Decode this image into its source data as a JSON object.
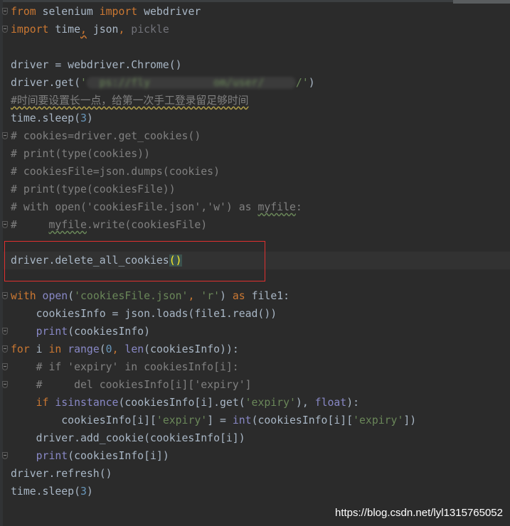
{
  "colors": {
    "background": "#2b2b2b",
    "keyword": "#cc7832",
    "text": "#a9b7c6",
    "builtin": "#8888c6",
    "string": "#6a8759",
    "number": "#6897bb",
    "comment": "#808080",
    "highlight_box": "#e0302f"
  },
  "current_line": 15,
  "highlight_box_line": 15,
  "fold_lines": [
    1,
    2,
    8,
    13,
    17,
    19,
    20,
    21,
    22,
    26
  ],
  "lines": [
    [
      [
        "from",
        "k"
      ],
      [
        " selenium ",
        "t"
      ],
      [
        "import",
        "k"
      ],
      [
        " webdriver",
        "t"
      ]
    ],
    [
      [
        "import",
        "k"
      ],
      [
        " time",
        "t"
      ],
      [
        ",",
        "k wo"
      ],
      [
        " json",
        "t"
      ],
      [
        ", ",
        "k"
      ],
      [
        "pickle",
        "u"
      ]
    ],
    [],
    [
      [
        "driver = webdriver.Chrome()",
        "t"
      ]
    ],
    [
      [
        "driver.get(",
        "t"
      ],
      [
        "'",
        "s"
      ],
      [
        "  ps://fly          om/user/     ",
        "blur"
      ],
      [
        "/'",
        "s"
      ],
      [
        ")",
        "t"
      ]
    ],
    [
      [
        "#时间要设置长一点，给第一次手工登录留足够时间",
        "c wv"
      ]
    ],
    [
      [
        "time.sleep(",
        "t"
      ],
      [
        "3",
        "n"
      ],
      [
        ")",
        "t"
      ]
    ],
    [
      [
        "# cookies=driver.get_cookies()",
        "c"
      ]
    ],
    [
      [
        "# print(type(cookies))",
        "c"
      ]
    ],
    [
      [
        "# cookiesFile=json.dumps(cookies)",
        "c"
      ]
    ],
    [
      [
        "# print(type(cookiesFile))",
        "c"
      ]
    ],
    [
      [
        "# with open('cookiesFile.json','w') as ",
        "c"
      ],
      [
        "myfile",
        "c wg"
      ],
      [
        ":",
        "c"
      ]
    ],
    [
      [
        "#     ",
        "c"
      ],
      [
        "myfile",
        "c wg"
      ],
      [
        ".write(cookiesFile)",
        "c"
      ]
    ],
    [],
    [
      [
        "driver.delete_all_cookies",
        "t"
      ],
      [
        "()",
        "pm"
      ]
    ],
    [],
    [
      [
        "with ",
        "k"
      ],
      [
        "open",
        "b"
      ],
      [
        "(",
        "t"
      ],
      [
        "'cookiesFile.json'",
        "s"
      ],
      [
        ", ",
        "k"
      ],
      [
        "'r'",
        "s"
      ],
      [
        ") ",
        "t"
      ],
      [
        "as ",
        "k"
      ],
      [
        "file1:",
        "t"
      ]
    ],
    [
      [
        "    cookiesInfo = json.loads(file1.read())",
        "t"
      ]
    ],
    [
      [
        "    ",
        "t"
      ],
      [
        "print",
        "b"
      ],
      [
        "(cookiesInfo)",
        "t"
      ]
    ],
    [
      [
        "for ",
        "k"
      ],
      [
        "i ",
        "t"
      ],
      [
        "in ",
        "k"
      ],
      [
        "range",
        "b"
      ],
      [
        "(",
        "t"
      ],
      [
        "0",
        "n"
      ],
      [
        ", ",
        "k"
      ],
      [
        "len",
        "b"
      ],
      [
        "(cookiesInfo)):",
        "t"
      ]
    ],
    [
      [
        "    # if 'expiry' in cookiesInfo[i]:",
        "c"
      ]
    ],
    [
      [
        "    #     del cookiesInfo[i]['expiry']",
        "c"
      ]
    ],
    [
      [
        "    ",
        "t"
      ],
      [
        "if ",
        "k"
      ],
      [
        "isinstance",
        "b"
      ],
      [
        "(cookiesInfo[i].get(",
        "t"
      ],
      [
        "'expiry'",
        "s"
      ],
      [
        "), ",
        "t"
      ],
      [
        "float",
        "b"
      ],
      [
        "):",
        "t"
      ]
    ],
    [
      [
        "        cookiesInfo[i][",
        "t"
      ],
      [
        "'expiry'",
        "s"
      ],
      [
        "] = ",
        "t"
      ],
      [
        "int",
        "b"
      ],
      [
        "(cookiesInfo[i][",
        "t"
      ],
      [
        "'expiry'",
        "s"
      ],
      [
        "])",
        "t"
      ]
    ],
    [
      [
        "    driver.add_cookie(cookiesInfo[i])",
        "t"
      ]
    ],
    [
      [
        "    ",
        "t"
      ],
      [
        "print",
        "b"
      ],
      [
        "(cookiesInfo[i])",
        "t"
      ]
    ],
    [
      [
        "driver.refresh()",
        "t"
      ]
    ],
    [
      [
        "time.sleep(",
        "t"
      ],
      [
        "3",
        "n"
      ],
      [
        ")",
        "t"
      ]
    ]
  ],
  "watermark": "https://blog.csdn.net/lyl1315765052"
}
